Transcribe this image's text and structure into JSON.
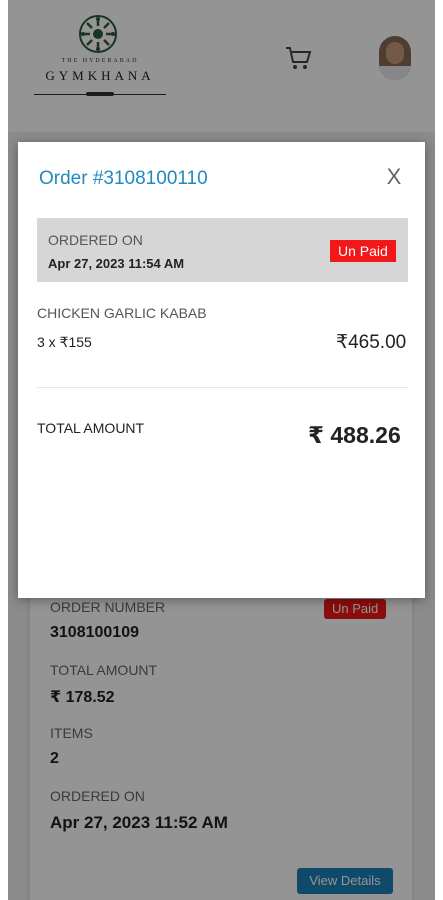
{
  "header": {
    "brand_small": "THE HYDERABAD",
    "brand_big": "GYMKHANA"
  },
  "order_card": {
    "order_number_label": "ORDER NUMBER",
    "order_number": "3108100109",
    "status": "Un Paid",
    "total_label": "TOTAL AMOUNT",
    "total": "₹ 178.52",
    "items_label": "ITEMS",
    "items": "2",
    "ordered_on_label": "ORDERED ON",
    "ordered_on": "Apr 27, 2023 11:52 AM",
    "view_details_label": "View Details"
  },
  "modal": {
    "title": "Order #3108100110",
    "close_glyph": "X",
    "ordered_on_label": "ORDERED ON",
    "ordered_on": "Apr 27, 2023 11:54 AM",
    "status": "Un Paid",
    "item_name": "CHICKEN GARLIC KABAB",
    "item_qty": "3 x ₹155",
    "item_price": "₹465.00",
    "total_label": "TOTAL AMOUNT",
    "total": "₹ 488.26"
  },
  "colors": {
    "accent": "#1f8ac0",
    "unpaid": "#f01818",
    "view_button": "#1a80b8"
  }
}
